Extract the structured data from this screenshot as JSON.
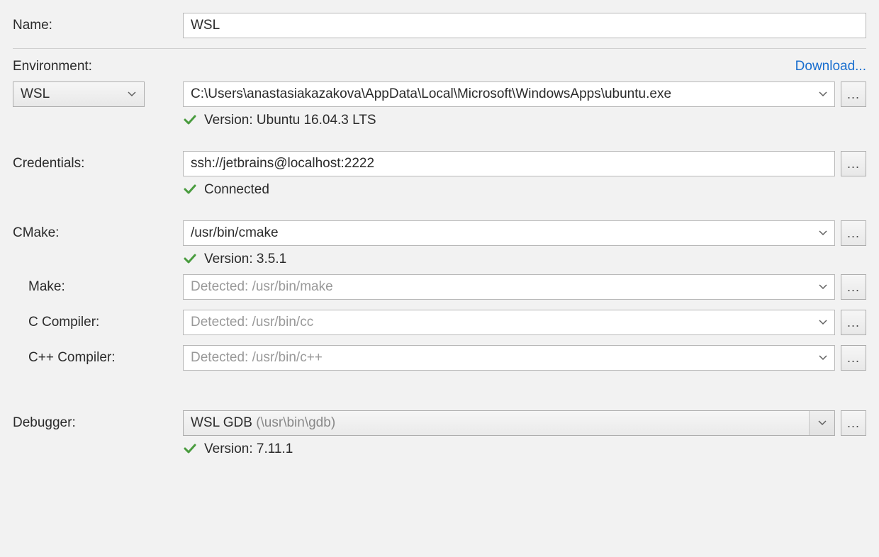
{
  "name": {
    "label": "Name:",
    "value": "WSL"
  },
  "environment": {
    "label": "Environment:",
    "download": "Download...",
    "type": "WSL",
    "path": "C:\\Users\\anastasiakazakova\\AppData\\Local\\Microsoft\\WindowsApps\\ubuntu.exe",
    "status": "Version: Ubuntu 16.04.3 LTS"
  },
  "credentials": {
    "label": "Credentials:",
    "value": "ssh://jetbrains@localhost:2222",
    "status": "Connected"
  },
  "cmake": {
    "label": "CMake:",
    "value": "/usr/bin/cmake",
    "status": "Version: 3.5.1"
  },
  "make": {
    "label": "Make:",
    "placeholder": "Detected: /usr/bin/make"
  },
  "ccompiler": {
    "label": "C Compiler:",
    "placeholder": "Detected: /usr/bin/cc"
  },
  "cxxcompiler": {
    "label": "C++ Compiler:",
    "placeholder": "Detected: /usr/bin/c++"
  },
  "debugger": {
    "label": "Debugger:",
    "name": "WSL GDB",
    "path": "(\\usr\\bin\\gdb)",
    "status": "Version: 7.11.1"
  },
  "icons": {
    "ellipsis": "..."
  }
}
